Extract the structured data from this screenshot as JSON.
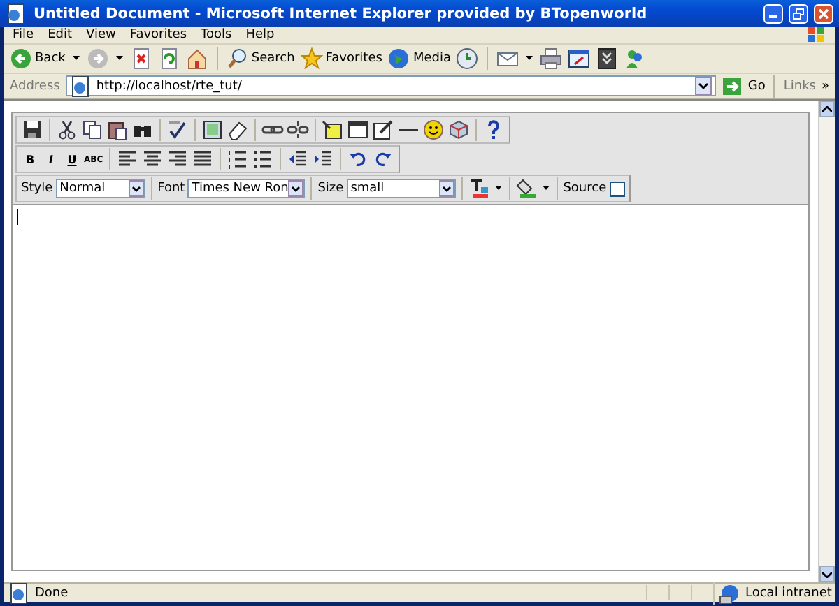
{
  "window": {
    "title": "Untitled Document - Microsoft Internet Explorer provided by BTopenworld"
  },
  "menu": [
    "File",
    "Edit",
    "View",
    "Favorites",
    "Tools",
    "Help"
  ],
  "nav_toolbar": {
    "back": "Back",
    "search": "Search",
    "favorites": "Favorites",
    "media": "Media"
  },
  "address_bar": {
    "label": "Address",
    "url": "http://localhost/rte_tut/",
    "go": "Go",
    "links": "Links",
    "more": "»"
  },
  "editor": {
    "format_buttons": [
      "B",
      "I",
      "U",
      "ABC"
    ],
    "style": {
      "label": "Style",
      "value": "Normal"
    },
    "font": {
      "label": "Font",
      "value": "Times New Ron"
    },
    "size": {
      "label": "Size",
      "value": "small"
    },
    "source": {
      "label": "Source",
      "checked": false
    }
  },
  "status_bar": {
    "text": "Done",
    "zone": "Local intranet"
  }
}
